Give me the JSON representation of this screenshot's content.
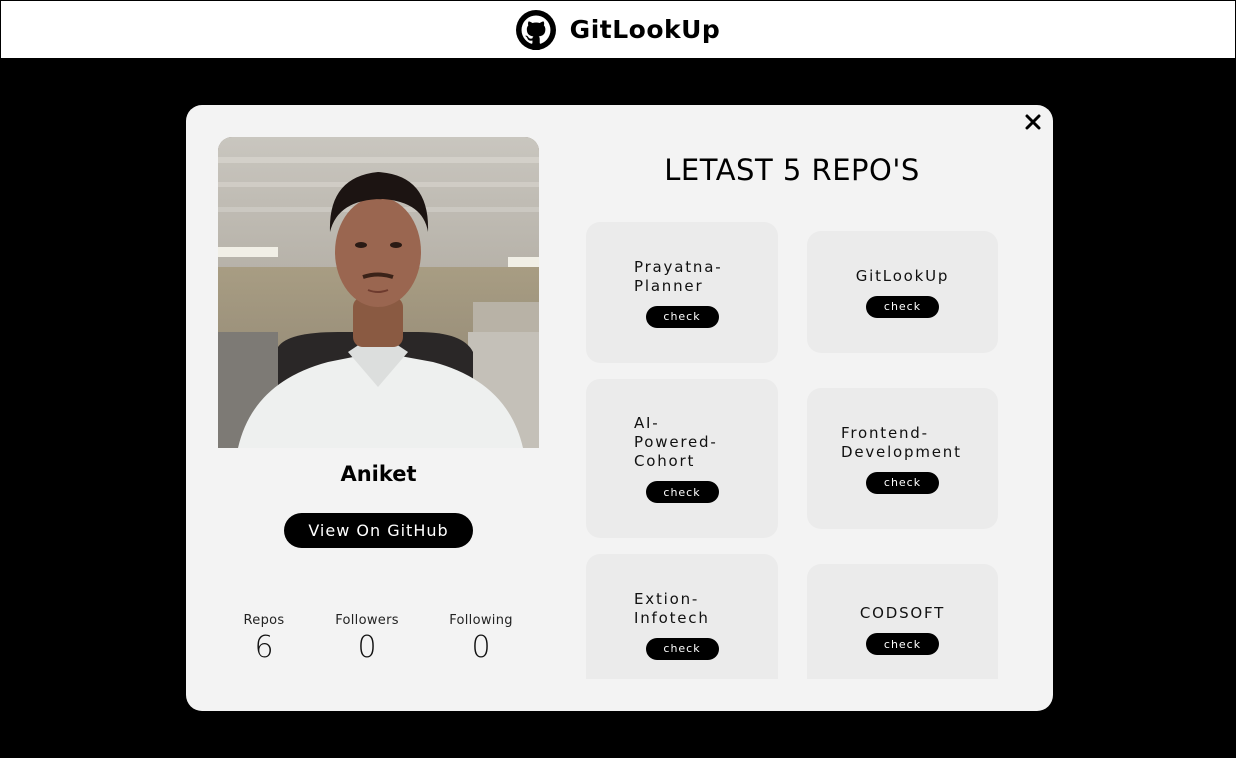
{
  "header": {
    "title": "GitLookUp",
    "logo_icon": "github-octocat-icon"
  },
  "profile": {
    "name": "Aniket",
    "view_button": "View On GitHub",
    "stats": [
      {
        "label": "Repos",
        "value": "6"
      },
      {
        "label": "Followers",
        "value": "0"
      },
      {
        "label": "Following",
        "value": "0"
      }
    ]
  },
  "repos": {
    "title": "LETAST 5 REPO'S",
    "check_label": "check",
    "items": [
      {
        "name": "Prayatna-Planner"
      },
      {
        "name": "GitLookUp"
      },
      {
        "name": "AI-Powered-Cohort"
      },
      {
        "name": "Frontend-Development"
      },
      {
        "name": "Extion-Infotech"
      },
      {
        "name": "CODSOFT"
      }
    ]
  },
  "modal": {
    "close_icon": "close-icon"
  },
  "colors": {
    "background": "#000000",
    "modal": "#f3f3f3",
    "card": "#ebebeb",
    "accent": "#000000"
  }
}
